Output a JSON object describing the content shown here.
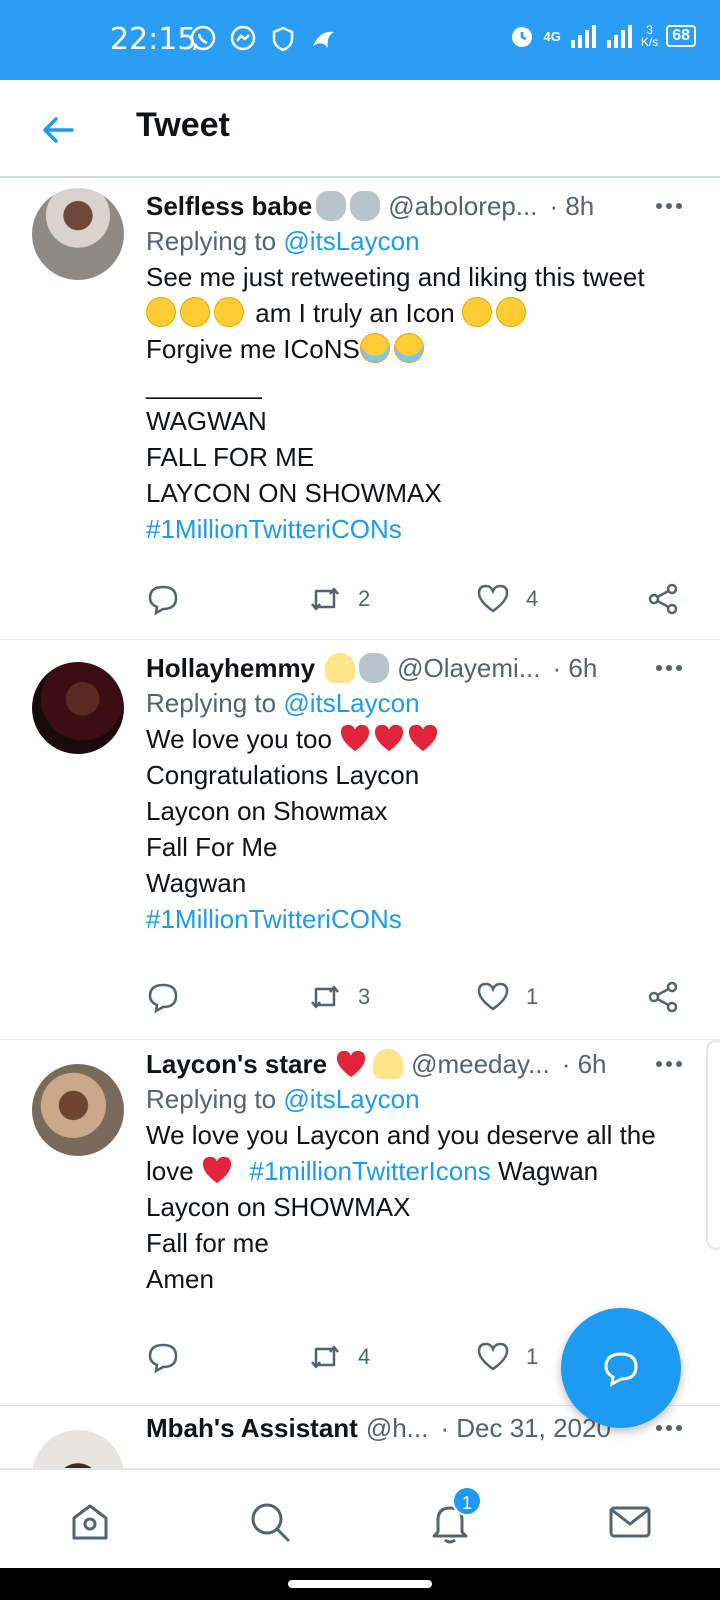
{
  "status_bar": {
    "time": "22:15",
    "network": "4G",
    "speed_value": "3",
    "speed_unit": "K/s",
    "battery": "68"
  },
  "header": {
    "title": "Tweet"
  },
  "tweets": [
    {
      "name": "Selfless babe",
      "handle": "@abolorep...",
      "time": "· 8h",
      "replying_prefix": "Replying to",
      "replying_to": "@itsLaycon",
      "lines": [
        "See me just retweeting and liking this tweet",
        "am I truly an Icon",
        "Forgive  me ICoNS",
        "________",
        "WAGWAN",
        "FALL FOR ME",
        "LAYCON ON SHOWMAX"
      ],
      "hashtag": "#1MillionTwitteriCONs",
      "retweets": "2",
      "likes": "4"
    },
    {
      "name": "Hollayhemmy",
      "handle": "@Olayemi...",
      "time": "· 6h",
      "replying_prefix": "Replying to",
      "replying_to": "@itsLaycon",
      "lines": [
        "We love you too",
        "Congratulations Laycon",
        "Laycon on Showmax",
        "Fall For Me",
        "Wagwan"
      ],
      "hashtag": "#1MillionTwitteriCONs",
      "retweets": "3",
      "likes": "1"
    },
    {
      "name": "Laycon's stare",
      "handle": "@meeday...",
      "time": "· 6h",
      "replying_prefix": "Replying to",
      "replying_to": "@itsLaycon",
      "lines": [
        "We love you Laycon and you deserve all the",
        "love",
        "Wagwan",
        "Laycon on SHOWMAX",
        "Fall for me",
        "Amen"
      ],
      "hashtag": "#1millionTwitterIcons",
      "retweets": "4",
      "likes": "1"
    },
    {
      "name": "Mbah's Assistant",
      "handle": "@h...",
      "time": "· Dec 31, 2020"
    }
  ],
  "notifications_badge": "1",
  "colors": {
    "status_bar": "#2a9df4",
    "accent": "#1d9bf0",
    "secondary_text": "#536471"
  },
  "icons": [
    "back-arrow-icon",
    "reply-icon",
    "retweet-icon",
    "like-icon",
    "share-icon",
    "more-icon",
    "home-icon",
    "search-icon",
    "notifications-icon",
    "messages-icon",
    "compose-icon"
  ]
}
